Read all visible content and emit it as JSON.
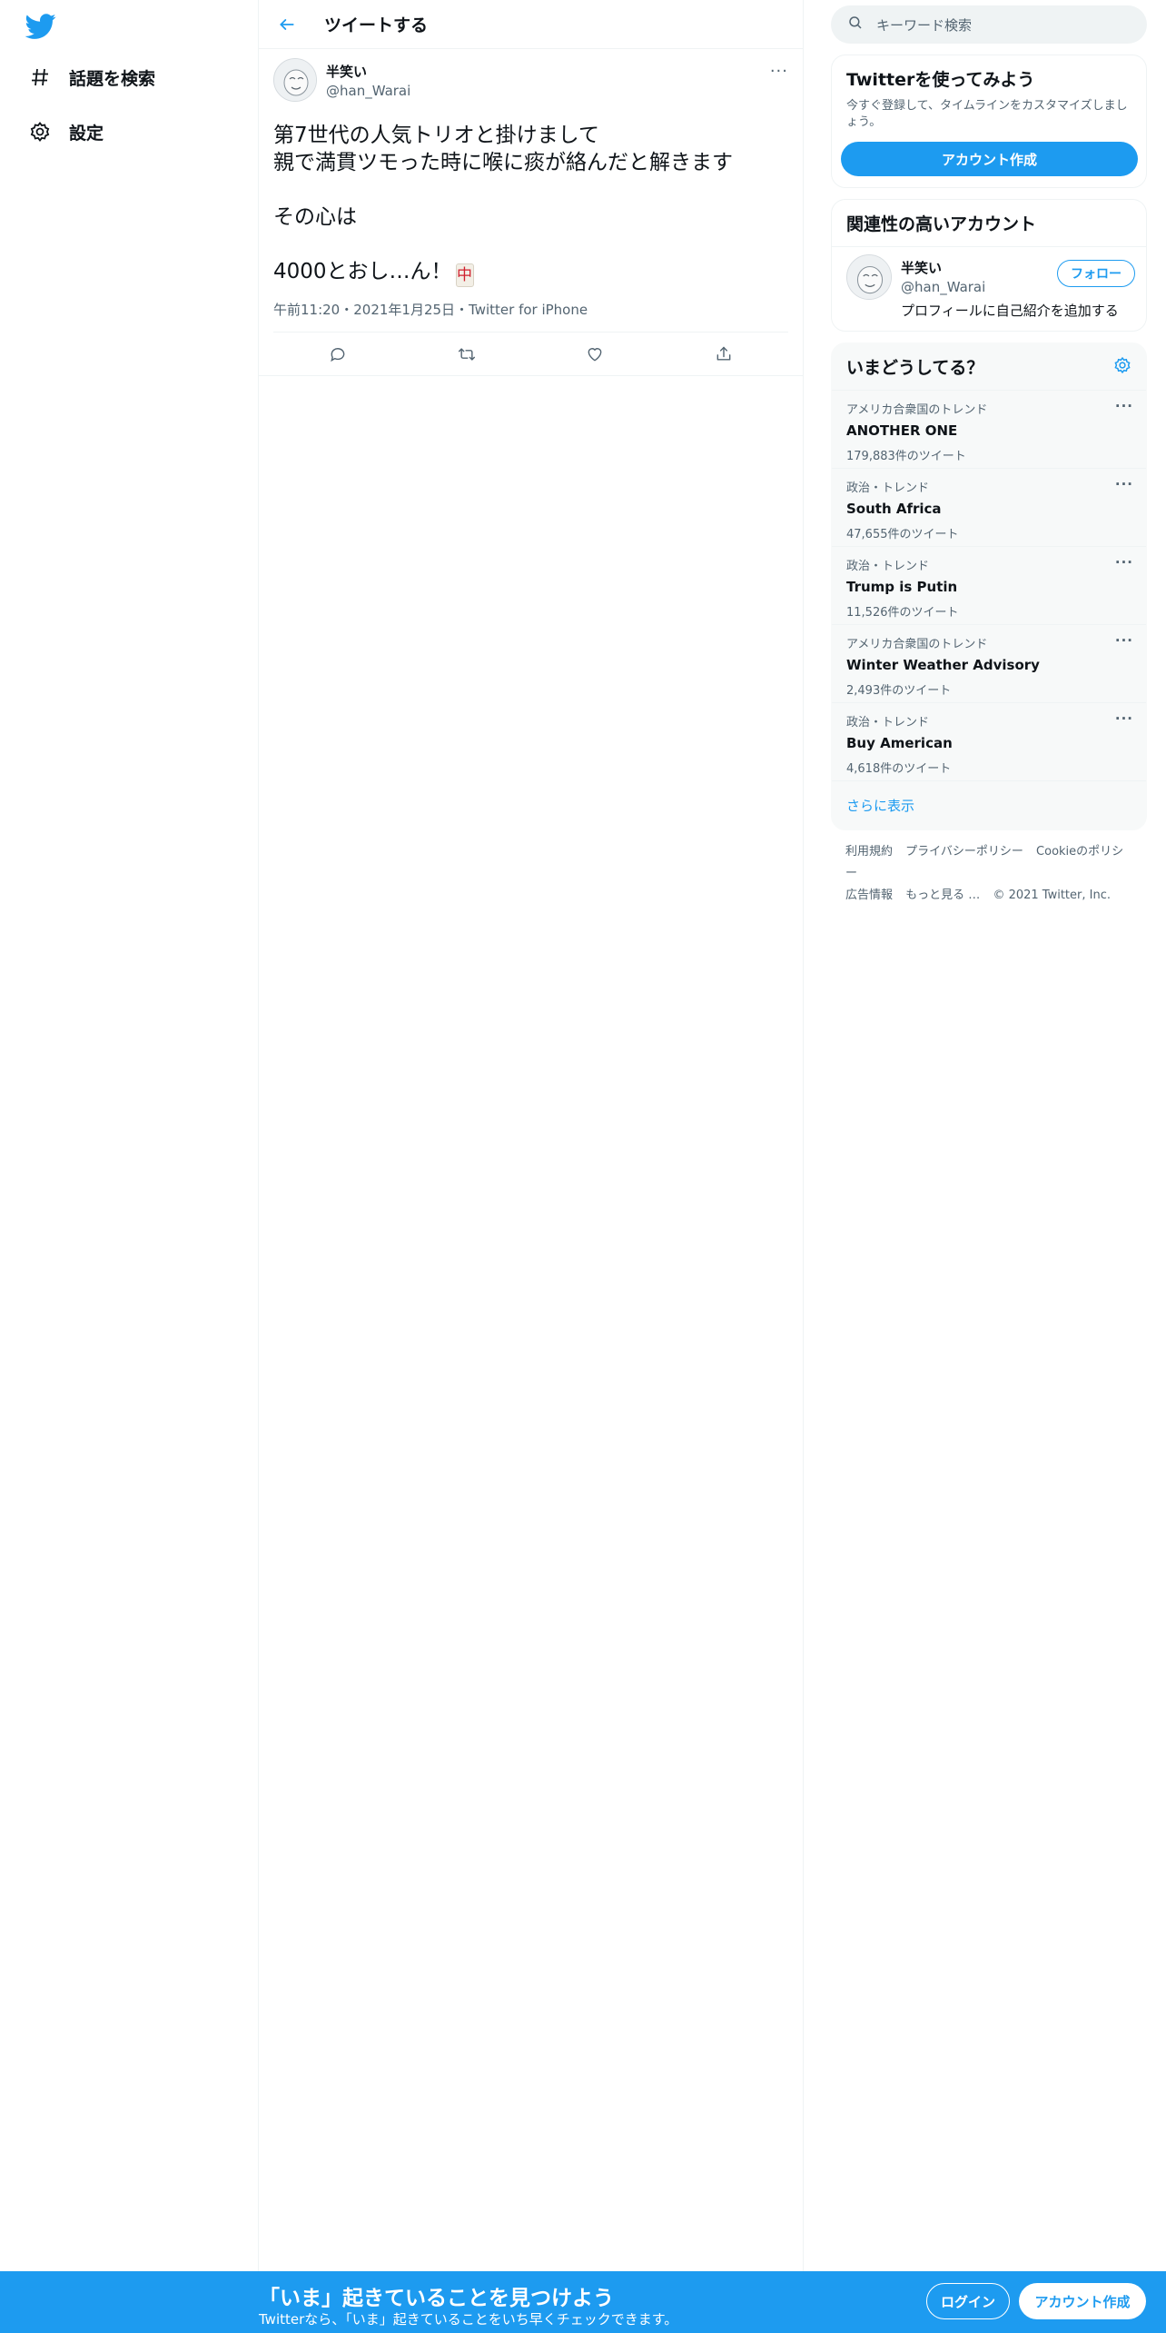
{
  "nav": {
    "logo_icon": "twitter-bird-icon",
    "explore_label": "話題を検索",
    "settings_label": "設定"
  },
  "main": {
    "header_title": "ツイートする",
    "tweet": {
      "display_name": "半笑い",
      "username": "@han_Warai",
      "line1": "第7世代の人気トリオと掛けまして",
      "line2": "親で満貫ツモった時に喉に痰が絡んだと解きます",
      "line3": "その心は",
      "line4": "4000とおし…ん！",
      "mahjong_tile": "中",
      "meta": "午前11:20・2021年1月25日・Twitter for iPhone"
    }
  },
  "sidebar": {
    "search_placeholder": "キーワード検索",
    "signup_card": {
      "title": "Twitterを使ってみよう",
      "desc": "今すぐ登録して、タイムラインをカスタマイズしましょう。",
      "button": "アカウント作成"
    },
    "relevant": {
      "title": "関連性の高いアカウント",
      "name": "半笑い",
      "handle": "@han_Warai",
      "bio": "プロフィールに自己紹介を追加する",
      "follow": "フォロー"
    },
    "trends": {
      "title": "いまどうしてる？",
      "items": [
        {
          "context": "アメリカ合衆国のトレンド",
          "name": "ANOTHER ONE",
          "count": "179,883件のツイート"
        },
        {
          "context": "政治・トレンド",
          "name": "South Africa",
          "count": "47,655件のツイート"
        },
        {
          "context": "政治・トレンド",
          "name": "Trump is Putin",
          "count": "11,526件のツイート"
        },
        {
          "context": "アメリカ合衆国のトレンド",
          "name": "Winter Weather Advisory",
          "count": "2,493件のツイート"
        },
        {
          "context": "政治・トレンド",
          "name": "Buy American",
          "count": "4,618件のツイート"
        }
      ],
      "show_more": "さらに表示"
    },
    "footer": {
      "terms": "利用規約",
      "privacy": "プライバシーポリシー",
      "cookie": "Cookieのポリシー",
      "ads": "広告情報",
      "more": "もっと見る …",
      "copyright": "© 2021 Twitter, Inc."
    }
  },
  "banner": {
    "title": "「いま」起きていることを見つけよう",
    "subtitle": "Twitterなら、「いま」起きていることをいち早くチェックできます。",
    "login": "ログイン",
    "signup": "アカウント作成"
  },
  "colors": {
    "brand": "#1d9bf0",
    "text": "#0f1419",
    "secondary": "#536471"
  }
}
